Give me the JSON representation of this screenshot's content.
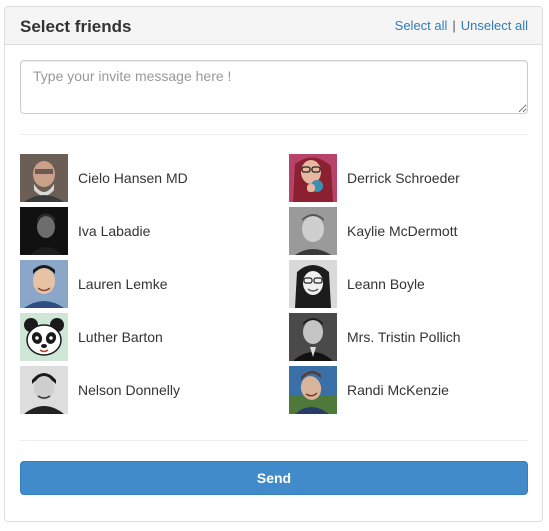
{
  "panel": {
    "title": "Select friends",
    "select_all": "Select all",
    "separator": "|",
    "unselect_all": "Unselect all"
  },
  "message": {
    "placeholder": "Type your invite message here !",
    "value": ""
  },
  "friends": [
    {
      "name": "Cielo Hansen MD",
      "avatar_bg": "#6b5e55",
      "avatar_fg": "#c9a08a"
    },
    {
      "name": "Derrick Schroeder",
      "avatar_bg": "#b7436a",
      "avatar_fg": "#e6b8a2"
    },
    {
      "name": "Iva Labadie",
      "avatar_bg": "#111111",
      "avatar_fg": "#6d6d6d"
    },
    {
      "name": "Kaylie McDermott",
      "avatar_bg": "#9a9a9a",
      "avatar_fg": "#cfcfcf"
    },
    {
      "name": "Lauren Lemke",
      "avatar_bg": "#8aa6c8",
      "avatar_fg": "#e8c2a4"
    },
    {
      "name": "Leann Boyle",
      "avatar_bg": "#d9d9d9",
      "avatar_fg": "#f0f0f0"
    },
    {
      "name": "Luther Barton",
      "avatar_bg": "#cfe6d7",
      "avatar_fg": "#1a1a1a"
    },
    {
      "name": "Mrs. Tristin Pollich",
      "avatar_bg": "#4a4a4a",
      "avatar_fg": "#c5c5c5"
    },
    {
      "name": "Nelson Donnelly",
      "avatar_bg": "#dddddd",
      "avatar_fg": "#222222"
    },
    {
      "name": "Randi McKenzie",
      "avatar_bg": "#3b6fa8",
      "avatar_fg": "#d8b59a"
    }
  ],
  "send_label": "Send",
  "colors": {
    "accent": "#428bca",
    "link": "#337ab7",
    "heading_bg": "#f5f5f5"
  }
}
